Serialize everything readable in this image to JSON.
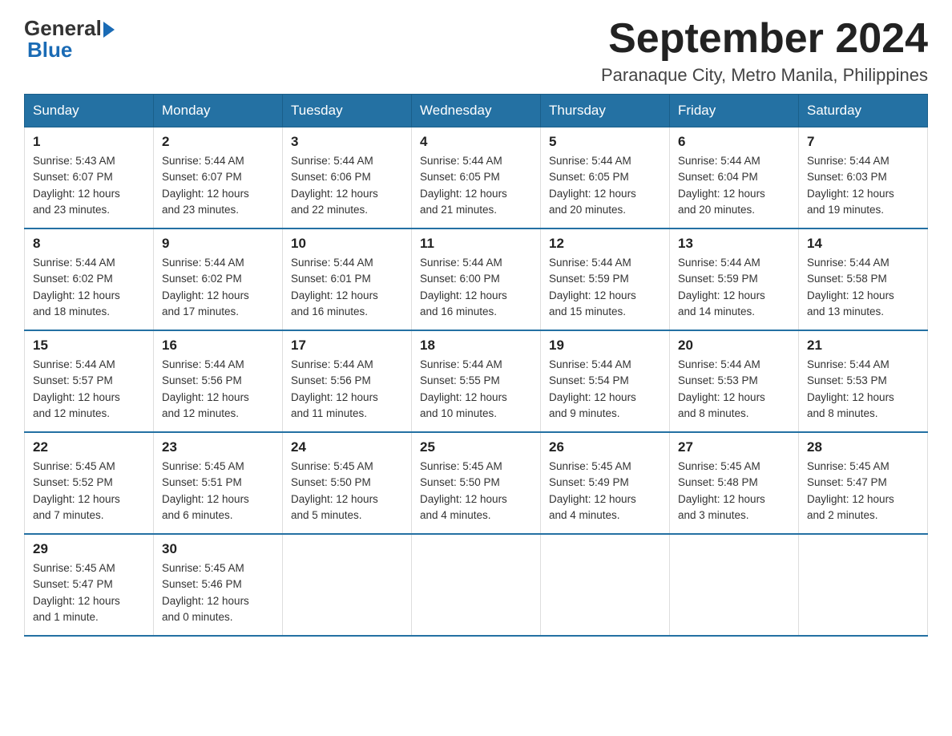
{
  "header": {
    "logo_general": "General",
    "logo_blue": "Blue",
    "month_title": "September 2024",
    "location": "Paranaque City, Metro Manila, Philippines"
  },
  "days_of_week": [
    "Sunday",
    "Monday",
    "Tuesday",
    "Wednesday",
    "Thursday",
    "Friday",
    "Saturday"
  ],
  "weeks": [
    [
      {
        "day": "1",
        "sunrise": "5:43 AM",
        "sunset": "6:07 PM",
        "daylight": "12 hours and 23 minutes."
      },
      {
        "day": "2",
        "sunrise": "5:44 AM",
        "sunset": "6:07 PM",
        "daylight": "12 hours and 23 minutes."
      },
      {
        "day": "3",
        "sunrise": "5:44 AM",
        "sunset": "6:06 PM",
        "daylight": "12 hours and 22 minutes."
      },
      {
        "day": "4",
        "sunrise": "5:44 AM",
        "sunset": "6:05 PM",
        "daylight": "12 hours and 21 minutes."
      },
      {
        "day": "5",
        "sunrise": "5:44 AM",
        "sunset": "6:05 PM",
        "daylight": "12 hours and 20 minutes."
      },
      {
        "day": "6",
        "sunrise": "5:44 AM",
        "sunset": "6:04 PM",
        "daylight": "12 hours and 20 minutes."
      },
      {
        "day": "7",
        "sunrise": "5:44 AM",
        "sunset": "6:03 PM",
        "daylight": "12 hours and 19 minutes."
      }
    ],
    [
      {
        "day": "8",
        "sunrise": "5:44 AM",
        "sunset": "6:02 PM",
        "daylight": "12 hours and 18 minutes."
      },
      {
        "day": "9",
        "sunrise": "5:44 AM",
        "sunset": "6:02 PM",
        "daylight": "12 hours and 17 minutes."
      },
      {
        "day": "10",
        "sunrise": "5:44 AM",
        "sunset": "6:01 PM",
        "daylight": "12 hours and 16 minutes."
      },
      {
        "day": "11",
        "sunrise": "5:44 AM",
        "sunset": "6:00 PM",
        "daylight": "12 hours and 16 minutes."
      },
      {
        "day": "12",
        "sunrise": "5:44 AM",
        "sunset": "5:59 PM",
        "daylight": "12 hours and 15 minutes."
      },
      {
        "day": "13",
        "sunrise": "5:44 AM",
        "sunset": "5:59 PM",
        "daylight": "12 hours and 14 minutes."
      },
      {
        "day": "14",
        "sunrise": "5:44 AM",
        "sunset": "5:58 PM",
        "daylight": "12 hours and 13 minutes."
      }
    ],
    [
      {
        "day": "15",
        "sunrise": "5:44 AM",
        "sunset": "5:57 PM",
        "daylight": "12 hours and 12 minutes."
      },
      {
        "day": "16",
        "sunrise": "5:44 AM",
        "sunset": "5:56 PM",
        "daylight": "12 hours and 12 minutes."
      },
      {
        "day": "17",
        "sunrise": "5:44 AM",
        "sunset": "5:56 PM",
        "daylight": "12 hours and 11 minutes."
      },
      {
        "day": "18",
        "sunrise": "5:44 AM",
        "sunset": "5:55 PM",
        "daylight": "12 hours and 10 minutes."
      },
      {
        "day": "19",
        "sunrise": "5:44 AM",
        "sunset": "5:54 PM",
        "daylight": "12 hours and 9 minutes."
      },
      {
        "day": "20",
        "sunrise": "5:44 AM",
        "sunset": "5:53 PM",
        "daylight": "12 hours and 8 minutes."
      },
      {
        "day": "21",
        "sunrise": "5:44 AM",
        "sunset": "5:53 PM",
        "daylight": "12 hours and 8 minutes."
      }
    ],
    [
      {
        "day": "22",
        "sunrise": "5:45 AM",
        "sunset": "5:52 PM",
        "daylight": "12 hours and 7 minutes."
      },
      {
        "day": "23",
        "sunrise": "5:45 AM",
        "sunset": "5:51 PM",
        "daylight": "12 hours and 6 minutes."
      },
      {
        "day": "24",
        "sunrise": "5:45 AM",
        "sunset": "5:50 PM",
        "daylight": "12 hours and 5 minutes."
      },
      {
        "day": "25",
        "sunrise": "5:45 AM",
        "sunset": "5:50 PM",
        "daylight": "12 hours and 4 minutes."
      },
      {
        "day": "26",
        "sunrise": "5:45 AM",
        "sunset": "5:49 PM",
        "daylight": "12 hours and 4 minutes."
      },
      {
        "day": "27",
        "sunrise": "5:45 AM",
        "sunset": "5:48 PM",
        "daylight": "12 hours and 3 minutes."
      },
      {
        "day": "28",
        "sunrise": "5:45 AM",
        "sunset": "5:47 PM",
        "daylight": "12 hours and 2 minutes."
      }
    ],
    [
      {
        "day": "29",
        "sunrise": "5:45 AM",
        "sunset": "5:47 PM",
        "daylight": "12 hours and 1 minute."
      },
      {
        "day": "30",
        "sunrise": "5:45 AM",
        "sunset": "5:46 PM",
        "daylight": "12 hours and 0 minutes."
      },
      null,
      null,
      null,
      null,
      null
    ]
  ],
  "labels": {
    "sunrise": "Sunrise:",
    "sunset": "Sunset:",
    "daylight": "Daylight:"
  }
}
